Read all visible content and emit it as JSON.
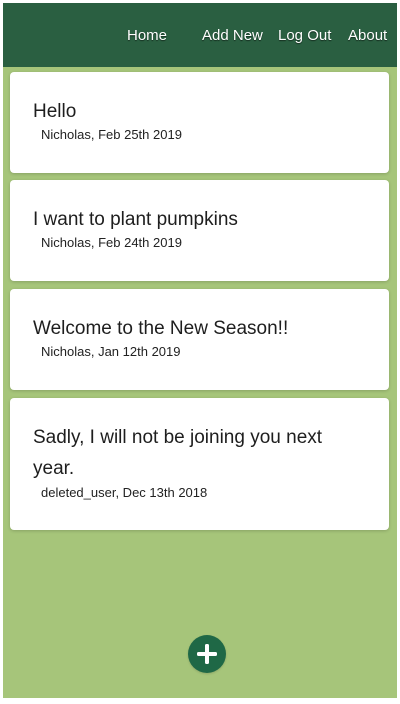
{
  "nav": {
    "items": [
      {
        "label": "Home"
      },
      {
        "label": "Add New"
      },
      {
        "label": "Log Out"
      },
      {
        "label": "About"
      }
    ]
  },
  "posts": [
    {
      "title": "Hello",
      "meta": "Nicholas, Feb 25th 2019"
    },
    {
      "title": "I want to plant pumpkins",
      "meta": "Nicholas, Feb 24th 2019"
    },
    {
      "title": "Welcome to the New Season!!",
      "meta": "Nicholas, Jan 12th 2019"
    },
    {
      "title": "Sadly, I will not be joining you next year.",
      "meta": "deleted_user, Dec 13th 2018"
    }
  ],
  "add_button": {
    "icon": "plus-icon"
  },
  "colors": {
    "header": "#2a5f41",
    "background": "#a6c57a",
    "card": "#ffffff",
    "add_button": "#1f6846"
  }
}
